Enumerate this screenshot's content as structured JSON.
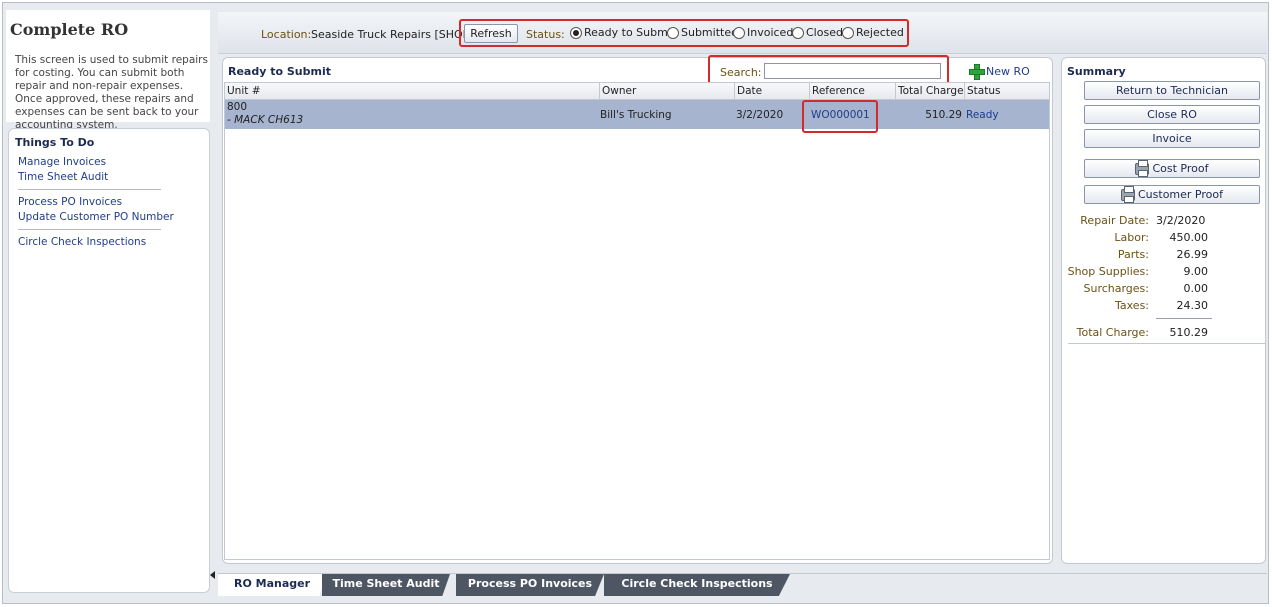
{
  "page": {
    "title": "Complete RO",
    "description": "This screen is used to submit repairs for costing. You can submit both repair and non-repair expenses. Once approved, these repairs and expenses can be sent back to your accounting system."
  },
  "things_to_do": {
    "title": "Things To Do",
    "links": [
      "Manage Invoices",
      "Time Sheet Audit",
      "Process PO Invoices",
      "Update Customer PO Number",
      "Circle Check Inspections"
    ]
  },
  "toolbar": {
    "location_label": "Location:",
    "location_value": "Seaside Truck Repairs [SHOP]",
    "refresh_label": "Refresh",
    "status_label": "Status:",
    "status_options": [
      "Ready to Submit",
      "Submitted",
      "Invoiced",
      "Closed",
      "Rejected"
    ],
    "status_selected": "Ready to Submit"
  },
  "grid": {
    "title": "Ready to Submit",
    "search_label": "Search:",
    "search_value": "",
    "new_ro_label": "New RO",
    "columns": [
      "Unit #",
      "Owner",
      "Date",
      "Reference",
      "Total Charge",
      "Status"
    ],
    "rows": [
      {
        "unit": "800",
        "unit_sub": "- MACK CH613",
        "owner": "Bill's Trucking",
        "date": "3/2/2020",
        "reference": "WO000001",
        "total_charge": "510.29",
        "status": "Ready"
      }
    ]
  },
  "summary": {
    "title": "Summary",
    "buttons": [
      "Return to Technician",
      "Close RO",
      "Invoice",
      "Cost Proof",
      "Customer Proof"
    ],
    "repair_date_label": "Repair Date:",
    "repair_date": "3/2/2020",
    "lines": [
      {
        "label": "Labor:",
        "value": "450.00"
      },
      {
        "label": "Parts:",
        "value": "26.99"
      },
      {
        "label": "Shop Supplies:",
        "value": "9.00"
      },
      {
        "label": "Surcharges:",
        "value": "0.00"
      },
      {
        "label": "Taxes:",
        "value": "24.30"
      }
    ],
    "total_label": "Total Charge:",
    "total_value": "510.29"
  },
  "tabs": [
    "RO Manager",
    "Time Sheet Audit",
    "Process PO Invoices",
    "Circle Check Inspections"
  ],
  "colors": {
    "accent_red": "#d42a2a",
    "row_selected": "#a6b4cf",
    "link_blue": "#1f3d8a",
    "tab_dark": "#4e5664"
  }
}
